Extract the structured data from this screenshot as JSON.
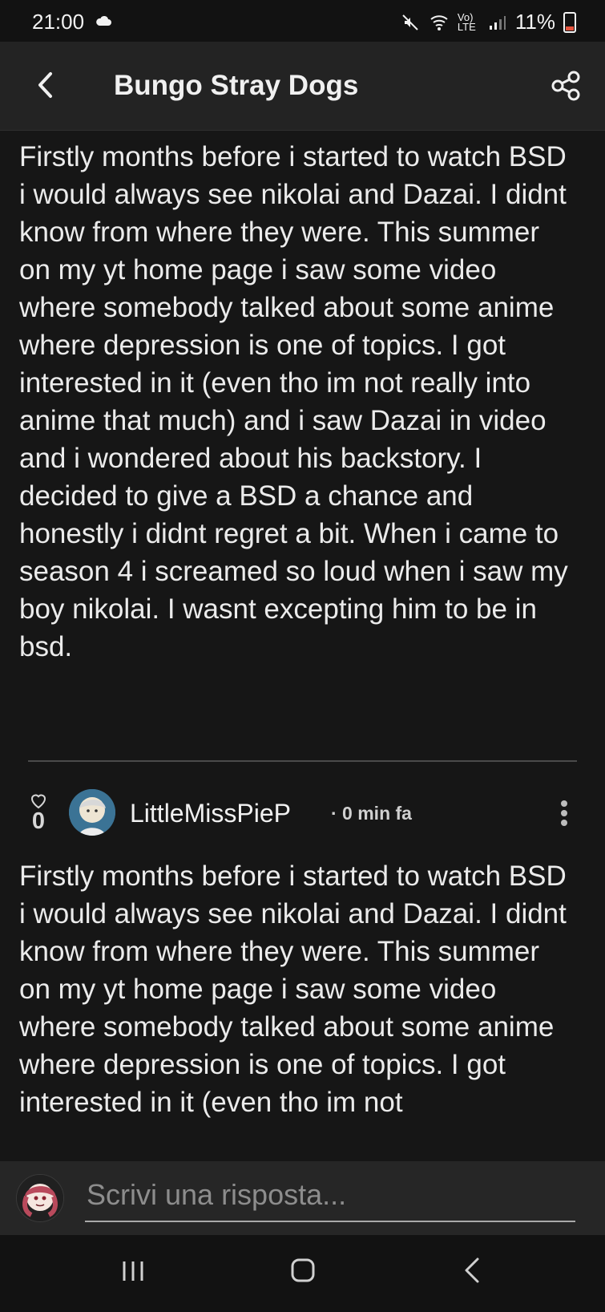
{
  "status_bar": {
    "time": "21:00",
    "network": "Vo) LTE",
    "battery": "11%",
    "icons": [
      "cloud-icon",
      "mute-icon",
      "wifi-icon",
      "signal-icon",
      "battery-icon"
    ]
  },
  "header": {
    "title": "Bungo Stray Dogs",
    "back_icon": "back-arrow-icon",
    "share_icon": "share-icon"
  },
  "post": {
    "body": "Firstly months before i started to watch BSD i would always see nikolai and Dazai. I didnt know from where they were. This summer on my yt home page i saw some video where somebody talked about some anime where depression is one of topics. I got interested in it (even tho im not really into anime that much) and i saw Dazai in video and i wondered about his backstory. I decided to give a BSD a chance and honestly i didnt regret a bit. When i came to season 4 i screamed so loud when i saw my boy nikolai. I wasnt excepting him to be in bsd."
  },
  "comment": {
    "like_count": "0",
    "author": "LittleMissPieP",
    "meta": "· 0 min fa",
    "body": "Firstly months before i started to watch BSD i would always see nikolai and Dazai. I didnt know from where they were. This summer on my yt home page i saw some video where somebody talked about some anime where depression is one of topics. I got interested in it (even tho im not"
  },
  "reply": {
    "placeholder": "Scrivi una risposta..."
  },
  "colors": {
    "background": "#161616",
    "header": "#232323",
    "text": "#ebebeb",
    "battery_low": "#e5533d"
  }
}
